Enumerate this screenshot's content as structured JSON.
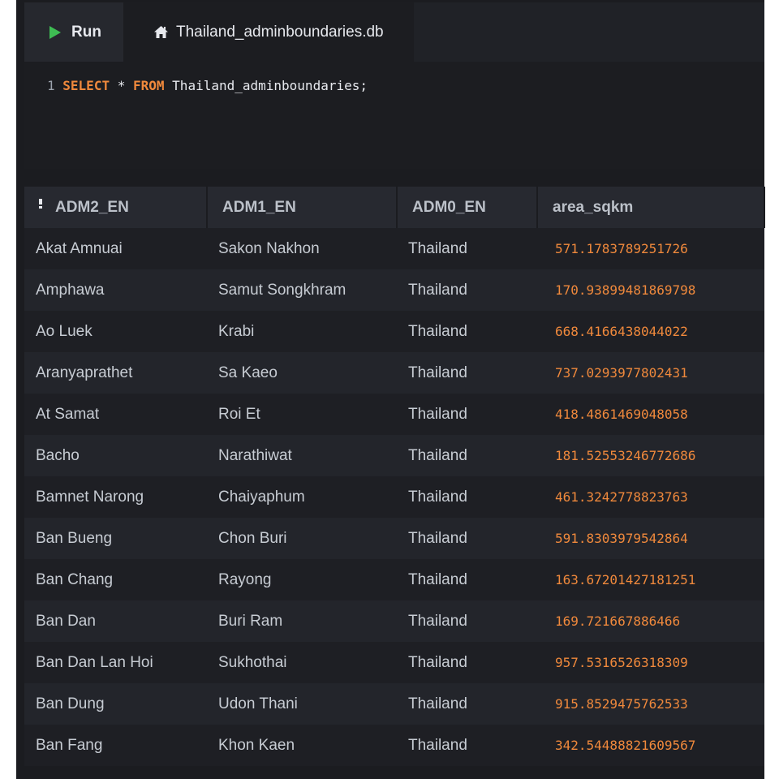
{
  "toolbar": {
    "run_label": "Run",
    "db_tab_label": "Thailand_adminboundaries.db"
  },
  "editor": {
    "line_number": "1",
    "code": {
      "kw_select": "SELECT",
      "star": "*",
      "kw_from": "FROM",
      "table": "Thailand_adminboundaries",
      "terminator": ";"
    }
  },
  "results": {
    "columns": [
      "ADM2_EN",
      "ADM1_EN",
      "ADM0_EN",
      "area_sqkm"
    ],
    "rows": [
      [
        "Akat Amnuai",
        "Sakon Nakhon",
        "Thailand",
        "571.1783789251726"
      ],
      [
        "Amphawa",
        "Samut Songkhram",
        "Thailand",
        "170.93899481869798"
      ],
      [
        "Ao Luek",
        "Krabi",
        "Thailand",
        "668.4166438044022"
      ],
      [
        "Aranyaprathet",
        "Sa Kaeo",
        "Thailand",
        "737.0293977802431"
      ],
      [
        "At Samat",
        "Roi Et",
        "Thailand",
        "418.4861469048058"
      ],
      [
        "Bacho",
        "Narathiwat",
        "Thailand",
        "181.52553246772686"
      ],
      [
        "Bamnet Narong",
        "Chaiyaphum",
        "Thailand",
        "461.3242778823763"
      ],
      [
        "Ban Bueng",
        "Chon Buri",
        "Thailand",
        "591.8303979542864"
      ],
      [
        "Ban Chang",
        "Rayong",
        "Thailand",
        "163.67201427181251"
      ],
      [
        "Ban Dan",
        "Buri Ram",
        "Thailand",
        "169.721667886466"
      ],
      [
        "Ban Dan Lan Hoi",
        "Sukhothai",
        "Thailand",
        "957.5316526318309"
      ],
      [
        "Ban Dung",
        "Udon Thani",
        "Thailand",
        "915.8529475762533"
      ],
      [
        "Ban Fang",
        "Khon Kaen",
        "Thailand",
        "342.54488821609567"
      ]
    ]
  }
}
